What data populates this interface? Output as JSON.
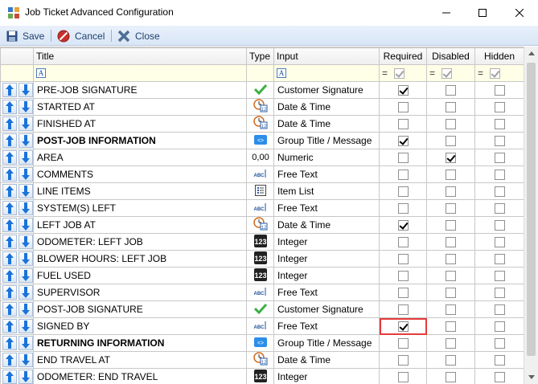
{
  "window": {
    "title": "Job Ticket Advanced Configuration",
    "controls": [
      "minimize",
      "maximize",
      "close"
    ]
  },
  "toolbar": {
    "save_label": "Save",
    "cancel_label": "Cancel",
    "close_label": "Close"
  },
  "columns": {
    "title": "Title",
    "type": "Type",
    "input": "Input",
    "required": "Required",
    "disabled": "Disabled",
    "hidden": "Hidden"
  },
  "filter": {
    "title_icon": "A",
    "input_icon": "A",
    "eq": "="
  },
  "rows": [
    {
      "title": "PRE-JOB SIGNATURE",
      "bold": false,
      "type_icon": "signature-check-icon",
      "input": "Customer Signature",
      "required": true,
      "disabled": false,
      "hidden": false
    },
    {
      "title": "STARTED AT",
      "bold": false,
      "type_icon": "date-time-icon",
      "input": "Date & Time",
      "required": false,
      "disabled": false,
      "hidden": false
    },
    {
      "title": "FINISHED AT",
      "bold": false,
      "type_icon": "date-time-icon",
      "input": "Date & Time",
      "required": false,
      "disabled": false,
      "hidden": false
    },
    {
      "title": "POST-JOB INFORMATION",
      "bold": true,
      "type_icon": "group-title-icon",
      "input": "Group Title / Message",
      "required": true,
      "disabled": false,
      "hidden": false
    },
    {
      "title": "AREA",
      "bold": false,
      "type_icon": "numeric-icon",
      "input": "Numeric",
      "required": false,
      "disabled": true,
      "hidden": false
    },
    {
      "title": "COMMENTS",
      "bold": false,
      "type_icon": "free-text-icon",
      "input": "Free Text",
      "required": false,
      "disabled": false,
      "hidden": false
    },
    {
      "title": "LINE ITEMS",
      "bold": false,
      "type_icon": "item-list-icon",
      "input": "Item List",
      "required": false,
      "disabled": false,
      "hidden": false
    },
    {
      "title": "SYSTEM(S) LEFT",
      "bold": false,
      "type_icon": "free-text-icon",
      "input": "Free Text",
      "required": false,
      "disabled": false,
      "hidden": false
    },
    {
      "title": "LEFT JOB AT",
      "bold": false,
      "type_icon": "date-time-icon",
      "input": "Date & Time",
      "required": true,
      "disabled": false,
      "hidden": false
    },
    {
      "title": "ODOMETER: LEFT JOB",
      "bold": false,
      "type_icon": "integer-icon",
      "input": "Integer",
      "required": false,
      "disabled": false,
      "hidden": false
    },
    {
      "title": "BLOWER HOURS: LEFT JOB",
      "bold": false,
      "type_icon": "integer-icon",
      "input": "Integer",
      "required": false,
      "disabled": false,
      "hidden": false
    },
    {
      "title": "FUEL USED",
      "bold": false,
      "type_icon": "integer-icon",
      "input": "Integer",
      "required": false,
      "disabled": false,
      "hidden": false
    },
    {
      "title": "SUPERVISOR",
      "bold": false,
      "type_icon": "free-text-icon",
      "input": "Free Text",
      "required": false,
      "disabled": false,
      "hidden": false
    },
    {
      "title": "POST-JOB SIGNATURE",
      "bold": false,
      "type_icon": "signature-check-icon",
      "input": "Customer Signature",
      "required": false,
      "disabled": false,
      "hidden": false
    },
    {
      "title": "SIGNED BY",
      "bold": false,
      "type_icon": "free-text-icon",
      "input": "Free Text",
      "required": true,
      "disabled": false,
      "hidden": false,
      "highlight": true
    },
    {
      "title": "RETURNING INFORMATION",
      "bold": true,
      "type_icon": "group-title-icon",
      "input": "Group Title / Message",
      "required": false,
      "disabled": false,
      "hidden": false
    },
    {
      "title": "END TRAVEL AT",
      "bold": false,
      "type_icon": "date-time-icon",
      "input": "Date & Time",
      "required": false,
      "disabled": false,
      "hidden": false
    },
    {
      "title": "ODOMETER: END TRAVEL",
      "bold": false,
      "type_icon": "integer-icon",
      "input": "Integer",
      "required": false,
      "disabled": false,
      "hidden": false
    }
  ],
  "icon_text": {
    "numeric": "0,00",
    "free_text": "ABC",
    "integer": "123",
    "date_num": "12"
  },
  "colors": {
    "highlight": "#e53b3b",
    "toolbar_text": "#1e3f6e",
    "arrow_blue": "#1a73d9",
    "filter_bg": "#ffffe7"
  }
}
